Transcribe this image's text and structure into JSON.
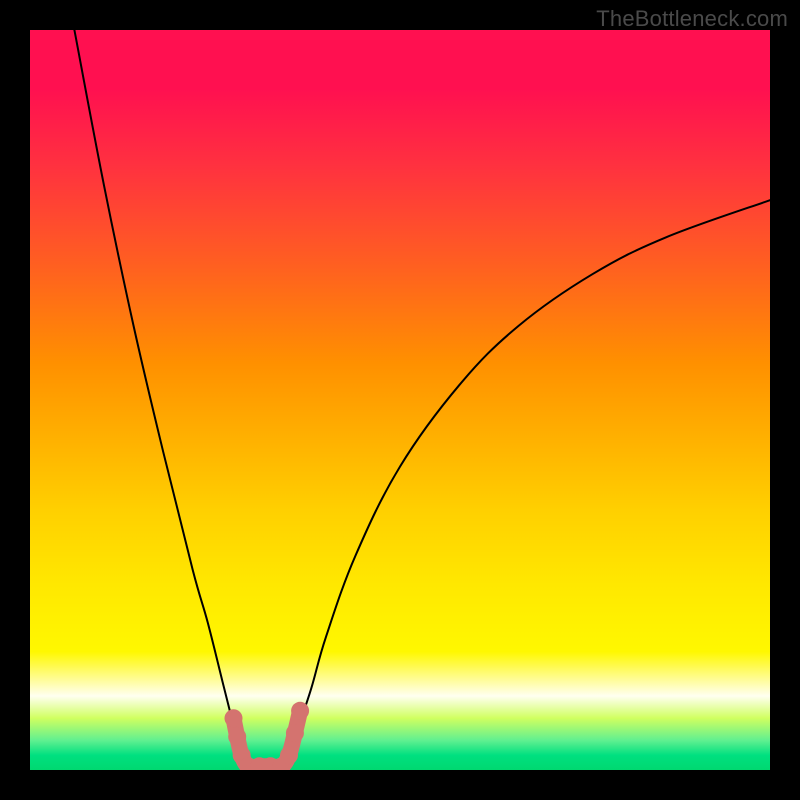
{
  "watermark": "TheBottleneck.com",
  "chart_data": {
    "type": "line",
    "title": "",
    "xlabel": "",
    "ylabel": "",
    "xlim": [
      0,
      100
    ],
    "ylim": [
      0,
      100
    ],
    "grid": false,
    "legend": false,
    "series": [
      {
        "name": "left-branch",
        "x": [
          6,
          10,
          14,
          18,
          22,
          24,
          26,
          27,
          28,
          29,
          30
        ],
        "y": [
          100,
          79,
          60,
          43,
          27,
          20,
          12,
          8,
          4,
          2,
          0
        ]
      },
      {
        "name": "right-branch",
        "x": [
          34,
          35,
          36,
          38,
          40,
          44,
          50,
          58,
          66,
          76,
          86,
          100
        ],
        "y": [
          0,
          2,
          5,
          11,
          18,
          29,
          41,
          52,
          60,
          67,
          72,
          77
        ]
      },
      {
        "name": "valley-floor",
        "x": [
          30,
          31,
          32,
          33,
          34
        ],
        "y": [
          0,
          0,
          0,
          0,
          0
        ]
      }
    ],
    "markers": [
      {
        "name": "left-marker-top",
        "x": 27.5,
        "y": 7,
        "color": "#d4736f"
      },
      {
        "name": "left-marker-mid",
        "x": 28.0,
        "y": 4.5,
        "color": "#d4736f"
      },
      {
        "name": "left-marker-low",
        "x": 28.6,
        "y": 2,
        "color": "#d4736f"
      },
      {
        "name": "floor-marker-1",
        "x": 29.5,
        "y": 0.5,
        "color": "#d4736f"
      },
      {
        "name": "floor-marker-2",
        "x": 31.0,
        "y": 0.5,
        "color": "#d4736f"
      },
      {
        "name": "floor-marker-3",
        "x": 32.5,
        "y": 0.5,
        "color": "#d4736f"
      },
      {
        "name": "floor-marker-4",
        "x": 34.0,
        "y": 0.5,
        "color": "#d4736f"
      },
      {
        "name": "right-marker-low",
        "x": 35.0,
        "y": 2,
        "color": "#d4736f"
      },
      {
        "name": "right-marker-mid",
        "x": 35.8,
        "y": 5,
        "color": "#d4736f"
      },
      {
        "name": "right-marker-top",
        "x": 36.5,
        "y": 8,
        "color": "#d4736f"
      }
    ],
    "gradient_stops": [
      {
        "pos": 0,
        "color": "#ff1050"
      },
      {
        "pos": 45,
        "color": "#ff9000"
      },
      {
        "pos": 75,
        "color": "#ffe800"
      },
      {
        "pos": 100,
        "color": "#00d870"
      }
    ]
  }
}
